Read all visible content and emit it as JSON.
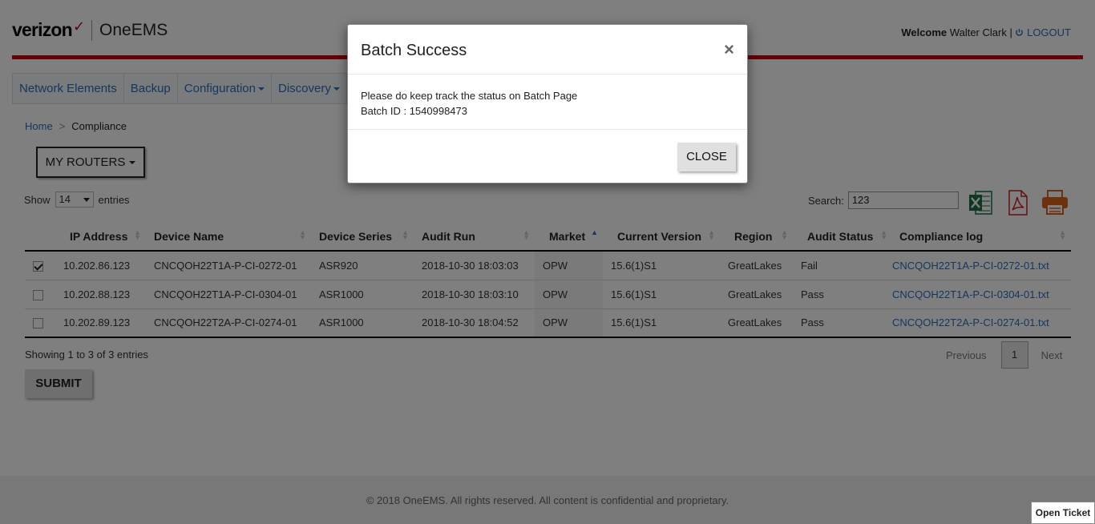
{
  "header": {
    "brand": "verizon",
    "brand_mark": "✓",
    "product": "OneEMS",
    "welcome_label": "Welcome",
    "user_name": "Walter Clark",
    "separator": "|",
    "logout_icon": "power-icon",
    "logout_label": "LOGOUT",
    "accent_color": "#cd040b"
  },
  "nav": {
    "items": [
      {
        "label": "Network Elements"
      },
      {
        "label": "Backup"
      },
      {
        "label": "Configuration"
      },
      {
        "label": "Discovery"
      }
    ]
  },
  "breadcrumb": {
    "home": "Home",
    "separator": ">",
    "current": "Compliance"
  },
  "my_routers": {
    "label": "MY ROUTERS"
  },
  "entries": {
    "show_label": "Show",
    "value": "14",
    "entries_label": "entries"
  },
  "search": {
    "label": "Search:",
    "value": "123"
  },
  "export_icons": [
    "excel-icon",
    "pdf-icon",
    "print-icon"
  ],
  "table": {
    "columns": [
      "",
      "IP Address",
      "Device Name",
      "Device Series",
      "Audit Run",
      "Market",
      "Current Version",
      "Region",
      "Audit Status",
      "Compliance log"
    ],
    "rows": [
      {
        "checked": true,
        "ip": "10.202.86.123",
        "device": "CNCQOH22T1A-P-CI-0272-01",
        "series": "ASR920",
        "audit_run": "2018-10-30 18:03:03",
        "market": "OPW",
        "version": "15.6(1)S1",
        "region": "GreatLakes",
        "status": "Fail",
        "log": "CNCQOH22T1A-P-CI-0272-01.txt"
      },
      {
        "checked": false,
        "ip": "10.202.88.123",
        "device": "CNCQOH22T1A-P-CI-0304-01",
        "series": "ASR1000",
        "audit_run": "2018-10-30 18:03:10",
        "market": "OPW",
        "version": "15.6(1)S1",
        "region": "GreatLakes",
        "status": "Pass",
        "log": "CNCQOH22T1A-P-CI-0304-01.txt"
      },
      {
        "checked": false,
        "ip": "10.202.89.123",
        "device": "CNCQOH22T2A-P-CI-0274-01",
        "series": "ASR1000",
        "audit_run": "2018-10-30 18:04:52",
        "market": "OPW",
        "version": "15.6(1)S1",
        "region": "GreatLakes",
        "status": "Pass",
        "log": "CNCQOH22T2A-P-CI-0274-01.txt"
      }
    ]
  },
  "info": "Showing 1 to 3 of 3 entries",
  "pager": {
    "previous": "Previous",
    "page": "1",
    "next": "Next"
  },
  "submit": {
    "label": "SUBMIT"
  },
  "footer": {
    "text": "© 2018 OneEMS. All rights reserved. All content is confidential and proprietary."
  },
  "open_ticket": {
    "label": "Open Ticket"
  },
  "modal": {
    "title": "Batch Success",
    "close_glyph": "×",
    "message": "Please do keep track the status on Batch Page",
    "batch_id": "Batch ID : 1540998473",
    "close_label": "CLOSE"
  }
}
